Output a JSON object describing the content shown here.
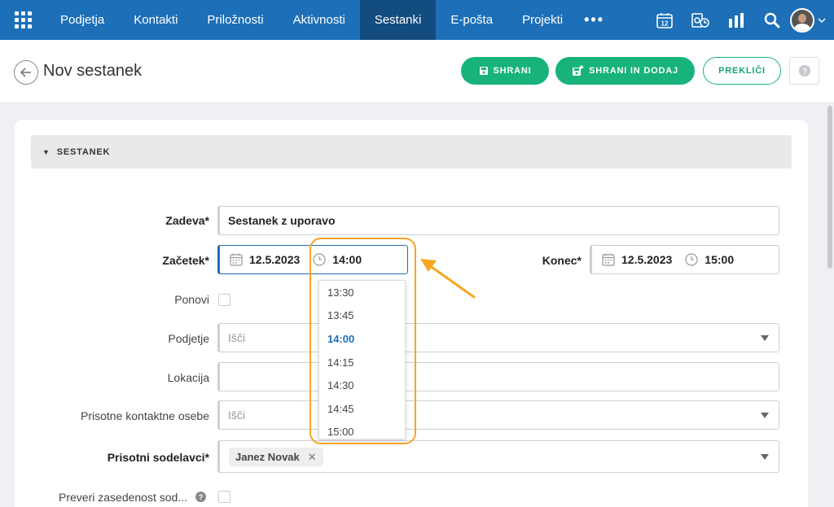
{
  "nav": {
    "items": [
      "Podjetja",
      "Kontakti",
      "Priložnosti",
      "Aktivnosti",
      "Sestanki",
      "E-pošta",
      "Projekti"
    ],
    "active": "Sestanki",
    "more": "•••",
    "calendar_day": "12"
  },
  "header": {
    "title": "Nov sestanek",
    "save_label": "SHRANI",
    "save_add_label": "SHRANI IN DODAJ",
    "cancel_label": "PREKLIČI"
  },
  "section": {
    "title": "SESTANEK"
  },
  "form": {
    "subject_label": "Zadeva*",
    "subject_value": "Sestanek z uporavo",
    "start_label": "Začetek*",
    "start_date": "12.5.2023",
    "start_time": "14:00",
    "end_label": "Konec*",
    "end_date": "12.5.2023",
    "end_time": "15:00",
    "repeat_label": "Ponovi",
    "company_label": "Podjetje",
    "company_placeholder": "Išči",
    "location_label": "Lokacija",
    "contacts_label": "Prisotne kontaktne osebe",
    "contacts_placeholder": "Išči",
    "colleagues_label": "Prisotni sodelavci*",
    "colleague_tag": "Janez Novak",
    "check_label": "Preveri zasedenost sod..."
  },
  "time_options": [
    "13:30",
    "13:45",
    "14:00",
    "14:15",
    "14:30",
    "14:45",
    "15:00"
  ],
  "selected_time": "14:00",
  "colors": {
    "nav": "#1d6fb8",
    "nav_active": "#134c7e",
    "green": "#17b37a",
    "highlight": "#f5a623"
  }
}
